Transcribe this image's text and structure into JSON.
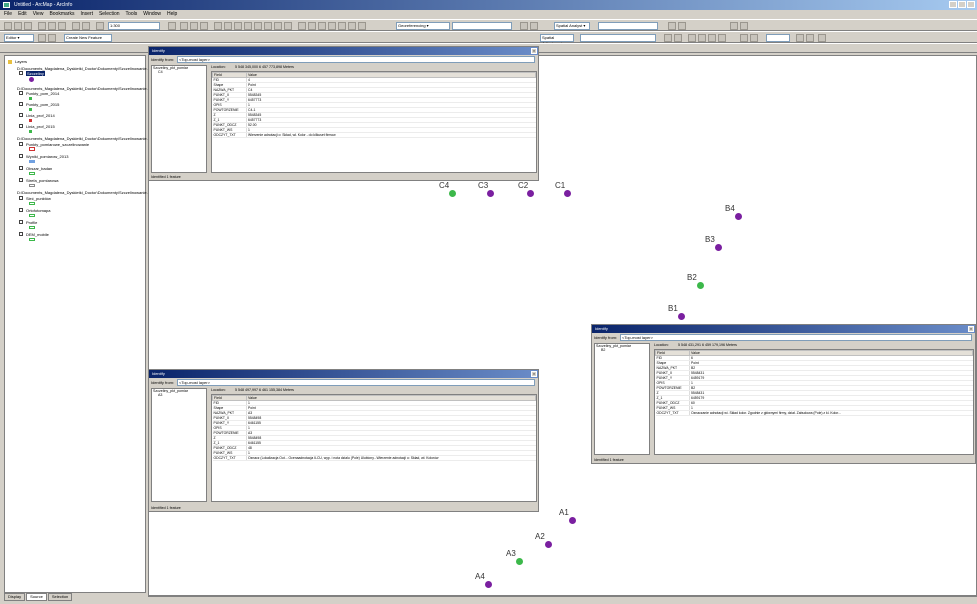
{
  "app": {
    "title": "Untitled - ArcMap - ArcInfo"
  },
  "menu": [
    "File",
    "Edit",
    "View",
    "Bookmarks",
    "Insert",
    "Selection",
    "Tools",
    "Window",
    "Help"
  ],
  "toolbar": {
    "scale": "1:300",
    "editor": "Editor ▾",
    "georeferencing": "Georeferencing ▾",
    "spatial_analyst": "Spatial Analyst ▾",
    "spatial_adjust": "Spatial Adjustment ▾",
    "task_label": "Create New Feature"
  },
  "toc": {
    "root": "Layers",
    "items": [
      "D:\\Documents_Magdalena_Dyskietki_Doctor\\Dokumenty\\Szczelinowanie...",
      "Szczeliny",
      "D:\\Documents_Magdalena_Dyskietki_Doctor\\Dokumenty\\Szczelinowanie...",
      "Punkty_pom_2014",
      "Punkty_pom_2015",
      "Linia_prof_2014",
      "Linia_prof_2015",
      "D:\\Documents_Magdalena_Dyskietki_Doctor\\Dokumenty\\Szczelinowanie...",
      "Punkty_pomiarowe_szczelinowanie",
      "Wyniki_pomiarow_2013",
      "Obszar_badan",
      "Strefa_pomiarowa",
      "D:\\Documents_Magdalena_Dyskietki_Doctor\\Dokumenty\\Szczelinowanie...",
      "Sieć_punktów",
      "Ortofotomapa",
      "Profile",
      "DEM_mobile"
    ],
    "tabs": [
      "Display",
      "Source",
      "Selection"
    ]
  },
  "map": {
    "points": [
      {
        "label": "C4",
        "color": "green"
      },
      {
        "label": "C3",
        "color": "purple"
      },
      {
        "label": "C2",
        "color": "purple"
      },
      {
        "label": "C1",
        "color": "purple"
      },
      {
        "label": "B4",
        "color": "purple"
      },
      {
        "label": "B3",
        "color": "purple"
      },
      {
        "label": "B2",
        "color": "green"
      },
      {
        "label": "B1",
        "color": "purple"
      },
      {
        "label": "A1",
        "color": "purple"
      },
      {
        "label": "A2",
        "color": "purple"
      },
      {
        "label": "A3",
        "color": "green"
      },
      {
        "label": "A4",
        "color": "purple"
      }
    ],
    "colors": {
      "purple": "#7a1fa0",
      "green": "#3cb84a"
    }
  },
  "identify": [
    {
      "title": "Identify",
      "from_label": "Identify from:",
      "from_value": "<Top-most layer>",
      "tree": [
        "Szczeliny_pkt_pomiar",
        "C4"
      ],
      "location_label": "Location:",
      "location_value": "5 548 345,000 6 457 773,898 Meters",
      "columns": [
        "Field",
        "Value"
      ],
      "rows": [
        [
          "FID",
          "4"
        ],
        [
          "Shape",
          "Point"
        ],
        [
          "NAZWA_PKT",
          "C4"
        ],
        [
          "PUNKT_X",
          "5548345"
        ],
        [
          "PUNKT_Y",
          "6457773"
        ],
        [
          "OPIS",
          "1"
        ],
        [
          "POWTORZENIE",
          "C4-1"
        ],
        [
          "Z",
          "5548345"
        ],
        [
          "Z_1",
          "6457773"
        ],
        [
          "PUNKT_ODCZ",
          "52.00"
        ],
        [
          "PUNKT_WS",
          "1"
        ],
        [
          "ODCZYT_TXT",
          "Wierzenie adnotacji o: Skład, wł. Kolor - do kilkuset firmow"
        ]
      ],
      "status": "Identified 1 feature"
    },
    {
      "title": "Identify",
      "from_label": "Identify from:",
      "from_value": "<Top-most layer>",
      "tree": [
        "Szczeliny_pkt_pomiar",
        "A3"
      ],
      "location_label": "Location:",
      "location_value": "5 548 497,997 6 461 155,384 Meters",
      "columns": [
        "Field",
        "Value"
      ],
      "rows": [
        [
          "FID",
          "1"
        ],
        [
          "Shape",
          "Point"
        ],
        [
          "NAZWA_PKT",
          "A3"
        ],
        [
          "PUNKT_X",
          "5548498"
        ],
        [
          "PUNKT_Y",
          "6461155"
        ],
        [
          "OPIS",
          "1"
        ],
        [
          "POWTORZENIE",
          "A3"
        ],
        [
          "Z",
          "5548498"
        ],
        [
          "Z_1",
          "6461155"
        ],
        [
          "PUNKT_ODCZ",
          "48"
        ],
        [
          "PUNKT_WS",
          "1"
        ],
        [
          "ODCZYT_TXT",
          "Oznacz (Lokalizacja Out... Ocenaadnotacja ILCU, wyp. i nota dzialu (Pole) Ulubiony...Wierzenie adnotacji o: Skład, wł. Kolorów"
        ]
      ],
      "status": "Identified 1 feature"
    },
    {
      "title": "Identify",
      "from_label": "Identify from:",
      "from_value": "<Top-most layer>",
      "tree": [
        "Szczeliny_pkt_pomiar",
        "B2"
      ],
      "location_label": "Location:",
      "location_value": "5 548 431,291 6 459 179,196 Meters",
      "columns": [
        "Field",
        "Value"
      ],
      "rows": [
        [
          "FID",
          "6"
        ],
        [
          "Shape",
          "Point"
        ],
        [
          "NAZWA_PKT",
          "B2"
        ],
        [
          "PUNKT_X",
          "5548431"
        ],
        [
          "PUNKT_Y",
          "6459179"
        ],
        [
          "OPIS",
          "1"
        ],
        [
          "POWTORZENIE",
          "B2"
        ],
        [
          "Z",
          "5548431"
        ],
        [
          "Z_1",
          "6459179"
        ],
        [
          "PUNKT_ODCZ",
          "60"
        ],
        [
          "PUNKT_WS",
          "1"
        ],
        [
          "ODCZYT_TXT",
          "Oznaczanie adnotacji wi. Skład kolor. Zgodnie z głównymi firmy, dział. Zabudowa (Pole) z kl. Kolor..."
        ]
      ],
      "status": "Identified 1 feature"
    }
  ],
  "status_bar": {
    "text": ""
  }
}
